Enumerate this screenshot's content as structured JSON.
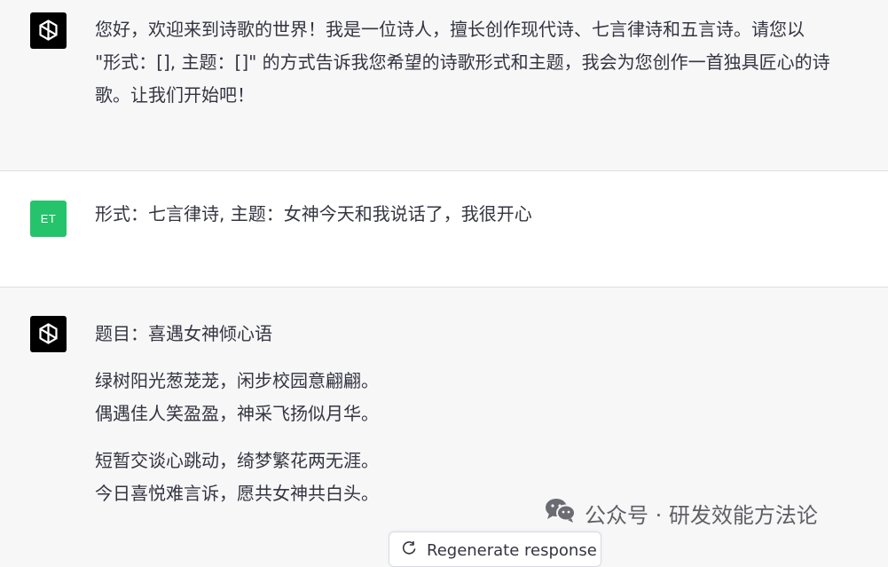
{
  "conversation": {
    "assistant_intro": {
      "avatar_icon": "openai-logo-icon",
      "lines": [
        "您好，欢迎来到诗歌的世界！我是一位诗人，擅长创作现代诗、七言律诗和五言诗。请您以",
        "\"形式：[], 主题：[]\" 的方式告诉我您希望的诗歌形式和主题，我会为您创作一首独具匠心的诗",
        "歌。让我们开始吧！"
      ]
    },
    "user_message": {
      "avatar_text": "ET",
      "text": "形式：七言律诗, 主题：女神今天和我说话了，我很开心"
    },
    "assistant_poem": {
      "avatar_icon": "openai-logo-icon",
      "title": "题目：喜遇女神倾心语",
      "stanza1": [
        "绿树阳光葱茏茏，闲步校园意翩翩。",
        "偶遇佳人笑盈盈，神采飞扬似月华。"
      ],
      "stanza2": [
        "短暂交谈心跳动，绮梦繁花两无涯。",
        "今日喜悦难言诉，愿共女神共白头。"
      ]
    }
  },
  "watermark": {
    "icon": "wechat-icon",
    "text": "公众号 · 研发效能方法论"
  },
  "regenerate_button": {
    "icon": "refresh-icon",
    "label": "Regenerate response"
  },
  "colors": {
    "assistant_bg": "#f7f7f8",
    "user_bg": "#ffffff",
    "user_avatar": "#25c36b",
    "gpt_avatar": "#000000"
  }
}
